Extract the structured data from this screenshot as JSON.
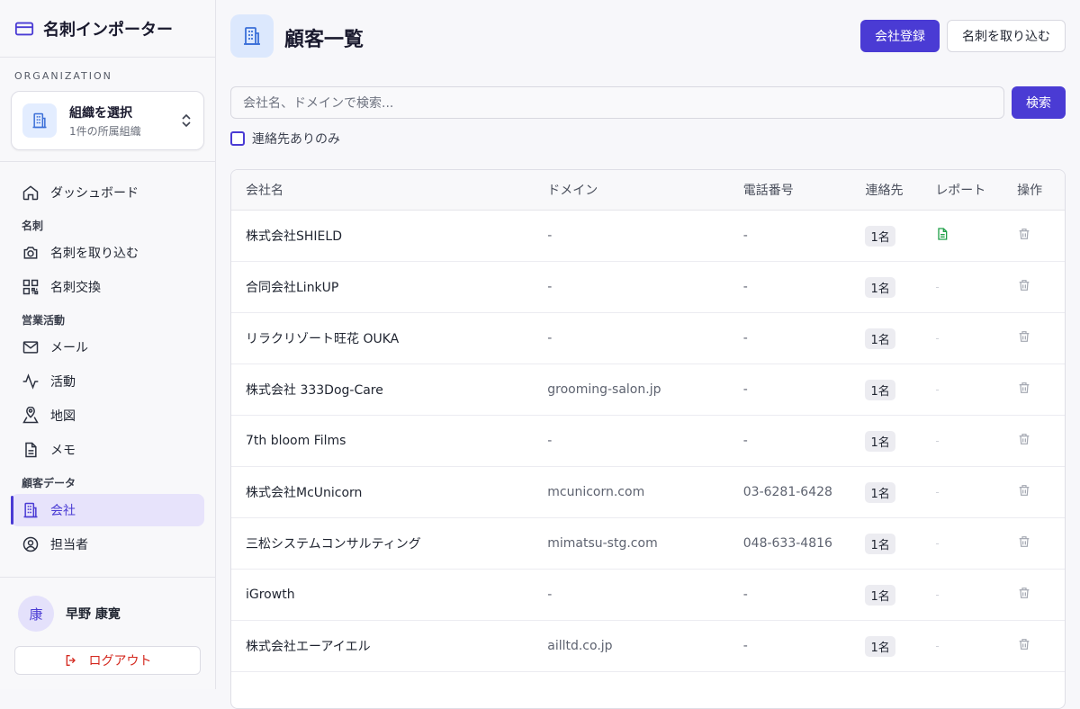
{
  "app": {
    "title": "名刺インポーター",
    "brand_color": "#4a3bd4"
  },
  "organization": {
    "heading": "ORGANIZATION",
    "name": "組織を選択",
    "subtitle": "1件の所属組織"
  },
  "nav": {
    "dashboard": "ダッシュボード",
    "group_meishi": "名刺",
    "import_cards": "名刺を取り込む",
    "exchange_cards": "名刺交換",
    "group_sales": "営業活動",
    "mail": "メール",
    "activity": "活動",
    "map": "地図",
    "memo": "メモ",
    "group_customer": "顧客データ",
    "company": "会社",
    "contact_person": "担当者"
  },
  "user": {
    "avatar_char": "康",
    "name": "早野 康寛"
  },
  "logout_label": "ログアウト",
  "page": {
    "title": "顧客一覧",
    "register_button": "会社登録",
    "import_button": "名刺を取り込む",
    "search_placeholder": "会社名、ドメインで検索...",
    "search_button": "検索",
    "filter_label": "連絡先ありのみ"
  },
  "table": {
    "headers": {
      "name": "会社名",
      "domain": "ドメイン",
      "phone": "電話番号",
      "contacts": "連絡先",
      "report": "レポート",
      "action": "操作"
    },
    "rows": [
      {
        "name": "株式会社SHIELD",
        "domain": "-",
        "phone": "-",
        "contacts": "1名",
        "report": "doc-icon"
      },
      {
        "name": "合同会社LinkUP",
        "domain": "-",
        "phone": "-",
        "contacts": "1名",
        "report": "-"
      },
      {
        "name": "リラクリゾート旺花 OUKA",
        "domain": "-",
        "phone": "-",
        "contacts": "1名",
        "report": "-"
      },
      {
        "name": "株式会社 333Dog-Care",
        "domain": "grooming-salon.jp",
        "phone": "-",
        "contacts": "1名",
        "report": "-"
      },
      {
        "name": "7th bloom Films",
        "domain": "-",
        "phone": "-",
        "contacts": "1名",
        "report": "-"
      },
      {
        "name": "株式会社McUnicorn",
        "domain": "mcunicorn.com",
        "phone": "03-6281-6428",
        "contacts": "1名",
        "report": "-"
      },
      {
        "name": "三松システムコンサルティング",
        "domain": "mimatsu-stg.com",
        "phone": "048-633-4816",
        "contacts": "1名",
        "report": "-"
      },
      {
        "name": "iGrowth",
        "domain": "-",
        "phone": "-",
        "contacts": "1名",
        "report": "-"
      },
      {
        "name": "株式会社エーアイエル",
        "domain": "ailltd.co.jp",
        "phone": "-",
        "contacts": "1名",
        "report": "-"
      }
    ]
  }
}
